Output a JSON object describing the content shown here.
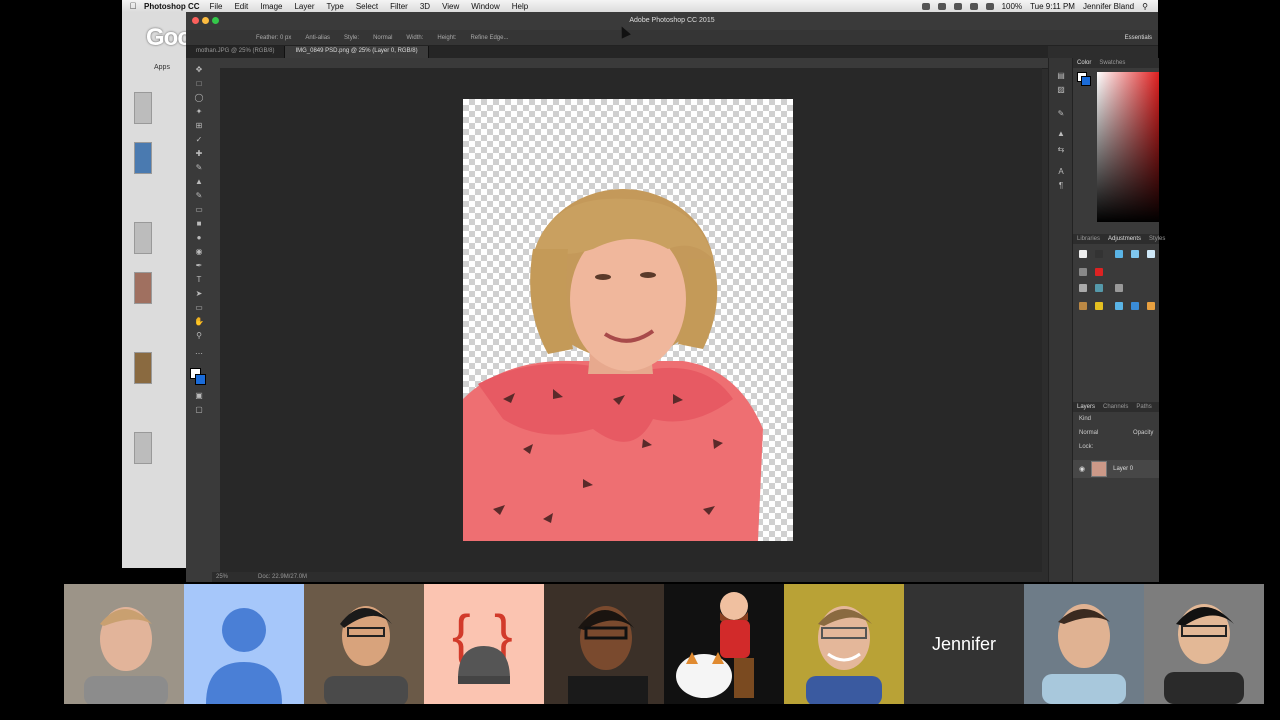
{
  "menubar": {
    "app_name": "Photoshop CC",
    "items": [
      "File",
      "Edit",
      "Image",
      "Layer",
      "Type",
      "Select",
      "Filter",
      "3D",
      "View",
      "Window",
      "Help"
    ],
    "battery": "100%",
    "time": "Tue 9:11 PM",
    "user": "Jennifer Bland"
  },
  "chrome_bg": {
    "logo": "Google",
    "apps_label": "Apps"
  },
  "photoshop": {
    "window_title": "Adobe Photoshop CC 2015",
    "options": {
      "feather": "Feather: 0 px",
      "anti_alias": "Anti-alias",
      "style_label": "Style:",
      "style_value": "Normal",
      "width": "Width:",
      "height": "Height:",
      "refine": "Refine Edge...",
      "workspace": "Essentials"
    },
    "tabs": [
      {
        "label": "mothan.JPG @ 25% (RGB/8)",
        "active": false
      },
      {
        "label": "IMG_0849 PSD.png @ 25% (Layer 0, RGB/8)",
        "active": true
      }
    ],
    "status": {
      "zoom": "25%",
      "doc": "Doc: 22.9M/27.0M"
    },
    "panels": {
      "color_tabs": [
        "Color",
        "Swatches"
      ],
      "lib_tabs": [
        "Libraries",
        "Adjustments",
        "Styles"
      ],
      "layer_tabs": [
        "Layers",
        "Channels",
        "Paths"
      ],
      "kind": "Kind",
      "blend_mode": "Normal",
      "opacity": "Opacity",
      "lock": "Lock:",
      "layer_name": "Layer 0"
    }
  },
  "participants": [
    {
      "type": "photo",
      "color": "#8a7a6a"
    },
    {
      "type": "avatar",
      "color": "#a4c3f8"
    },
    {
      "type": "photo",
      "color": "#6b5a48"
    },
    {
      "type": "logo",
      "color": "#fbc2b0"
    },
    {
      "type": "photo",
      "color": "#3b3028"
    },
    {
      "type": "cartoon",
      "color": "#ffffff"
    },
    {
      "type": "photo",
      "color": "#b9a236"
    },
    {
      "type": "name",
      "label": "Jennifer",
      "color": "#333333"
    },
    {
      "type": "photo",
      "color": "#6e7c88"
    },
    {
      "type": "photo",
      "color": "#7d7d7d"
    }
  ]
}
